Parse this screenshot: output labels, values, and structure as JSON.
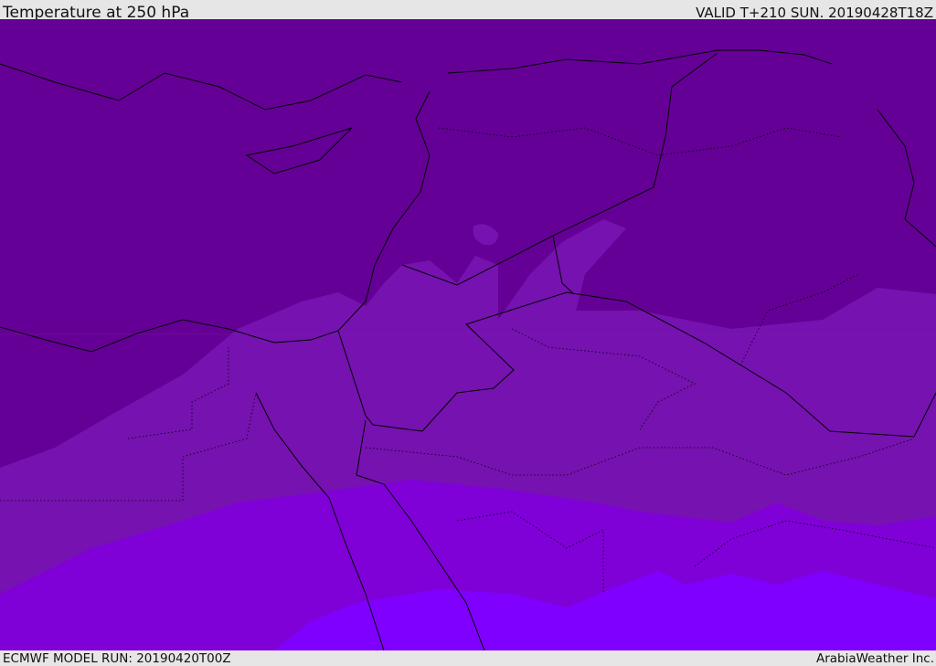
{
  "header": {
    "title": "Temperature at 250 hPa",
    "valid": "VALID T+210 SUN. 20190428T18Z"
  },
  "footer": {
    "model_run": "ECMWF MODEL RUN: 20190420T00Z",
    "credit": "ArabiaWeather Inc."
  },
  "map": {
    "band_colors": [
      "#650096",
      "#7612b0",
      "#8000d8",
      "#7f00ff"
    ],
    "border_color": "#000000"
  }
}
